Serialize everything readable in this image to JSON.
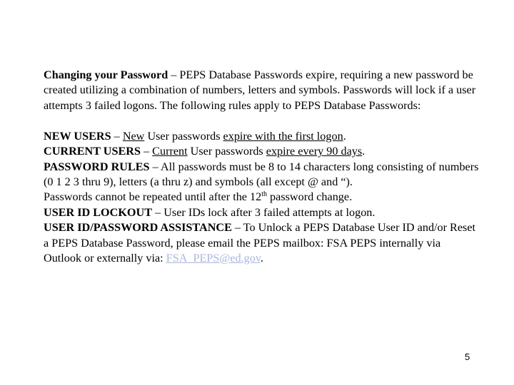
{
  "intro": {
    "heading": "Changing your Password",
    "dash": " – ",
    "text": "PEPS Database Passwords expire, requiring a new password be created utilizing a combination of numbers, letters and symbols. Passwords will lock if a user attempts 3 failed logons.  The following rules apply to PEPS Database Passwords:"
  },
  "rules": {
    "new_users": {
      "label": "NEW USERS",
      "dash": " – ",
      "u1": "New",
      "mid": " User passwords ",
      "u2": "expire with the first logon",
      "end": "."
    },
    "current_users": {
      "label": "CURRENT USERS",
      "dash": " – ",
      "u1": "Current",
      "mid": " User passwords ",
      "u2": "expire every 90 days",
      "end": "."
    },
    "password_rules": {
      "label": "PASSWORD RULES",
      "dash": " – ",
      "text": "All passwords must be 8 to 14 characters long consisting of numbers (0 1 2 3 thru 9), letters (a thru z) and symbols (all except @ and “).",
      "repeat_pre": "Passwords cannot be repeated until after the 12",
      "repeat_sup": "th",
      "repeat_post": " password change."
    },
    "lockout": {
      "label": "USER ID LOCKOUT",
      "dash": " – ",
      "text": "User IDs lock after 3  failed attempts at logon."
    },
    "assistance": {
      "label": "USER ID/PASSWORD ASSISTANCE",
      "dash": " – ",
      "text": "To Unlock a PEPS Database User ID and/or Reset a PEPS Database Password, please email the PEPS mailbox: FSA PEPS internally via Outlook or externally via: ",
      "email": "FSA_PEPS@ed.gov",
      "end": "."
    }
  },
  "page_number": "5",
  "colors": {
    "link": "#aab6dc",
    "text": "#000000"
  }
}
